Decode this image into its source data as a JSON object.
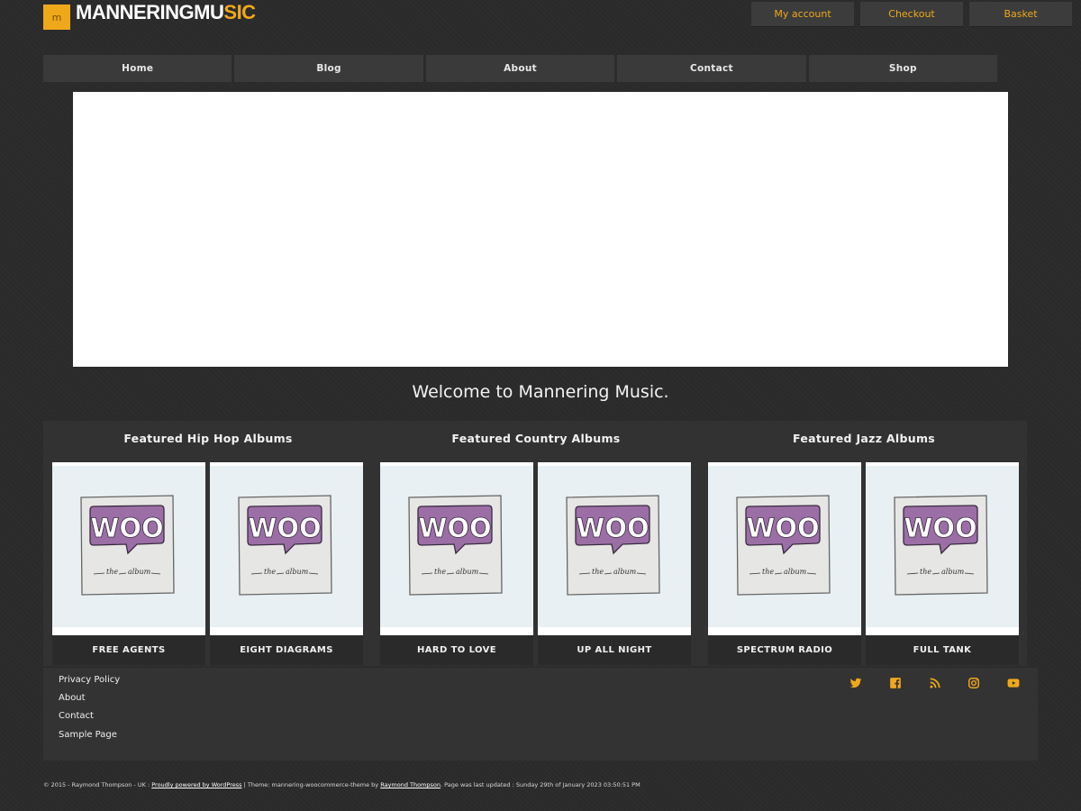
{
  "header": {
    "logo_icon_letter": "m",
    "logo_part1": "MANNERINGMU",
    "logo_part2": "SIC",
    "account_links": [
      "My account",
      "Checkout",
      "Basket"
    ]
  },
  "nav": {
    "items": [
      "Home",
      "Blog",
      "About",
      "Contact",
      "Shop"
    ]
  },
  "welcome": "Welcome to Mannering Music.",
  "featured": [
    {
      "title": "Featured Hip Hop Albums",
      "albums": [
        "FREE AGENTS",
        "EIGHT DIAGRAMS"
      ]
    },
    {
      "title": "Featured Country Albums",
      "albums": [
        "HARD TO LOVE",
        "UP ALL NIGHT"
      ]
    },
    {
      "title": "Featured Jazz Albums",
      "albums": [
        "SPECTRUM RADIO",
        "FULL TANK"
      ]
    }
  ],
  "album_art": {
    "logo": "WOO",
    "word1": "the",
    "word2": "album"
  },
  "footer": {
    "links": [
      "Privacy Policy",
      "About",
      "Contact",
      "Sample Page"
    ],
    "social_icons": [
      "twitter-icon",
      "facebook-icon",
      "rss-icon",
      "instagram-icon",
      "youtube-icon"
    ]
  },
  "credits": {
    "part1": "© 2015 - Raymond Thompson - UK : ",
    "link1": "Proudly powered by WordPress",
    "part2": " | Theme: mannering-woocommerce-theme by ",
    "link2": "Raymond Thompson",
    "part3": ". Page was last updated : Sunday 29th of January 2023 03:50:51 PM"
  },
  "colors": {
    "accent": "#f0a81b",
    "background": "#2b2b2b",
    "woo_purple": "#9b6fa6"
  }
}
